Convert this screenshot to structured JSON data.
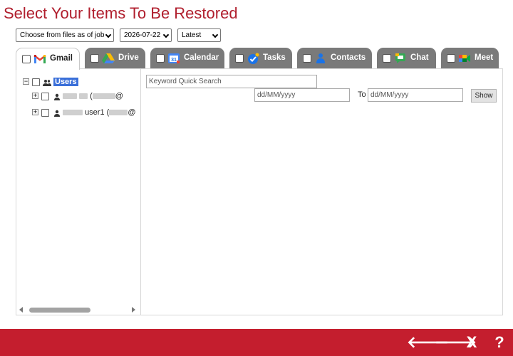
{
  "page": {
    "title": "Select Your Items To Be Restored"
  },
  "filters": {
    "source": "Choose from files as of job",
    "date": "2026-07-22",
    "version": "Latest"
  },
  "tabs": [
    {
      "label": "Gmail",
      "icon": "gmail-icon",
      "active": true
    },
    {
      "label": "Drive",
      "icon": "drive-icon"
    },
    {
      "label": "Calendar",
      "icon": "calendar-icon"
    },
    {
      "label": "Tasks",
      "icon": "tasks-icon"
    },
    {
      "label": "Contacts",
      "icon": "contacts-icon"
    },
    {
      "label": "Chat",
      "icon": "chat-icon"
    },
    {
      "label": "Meet",
      "icon": "meet-icon"
    }
  ],
  "tree": {
    "root_label": "Users",
    "items": [
      {
        "prefix": "(",
        "suffix": "@"
      },
      {
        "label": "user1",
        "prefix": "(",
        "suffix": "@"
      }
    ]
  },
  "search": {
    "keyword_placeholder": "Keyword Quick Search",
    "from_placeholder": "dd/MM/yyyy",
    "to_label": "To",
    "to_placeholder": "dd/MM/yyyy",
    "show_label": "Show"
  },
  "footer": {
    "back": "🡐",
    "next": "🡒",
    "close": "X",
    "help": "?"
  },
  "colors": {
    "brand": "#c41e2e",
    "title": "#b01e2d",
    "tab_bg": "#7a7a7a",
    "selection": "#3a6fd9"
  }
}
